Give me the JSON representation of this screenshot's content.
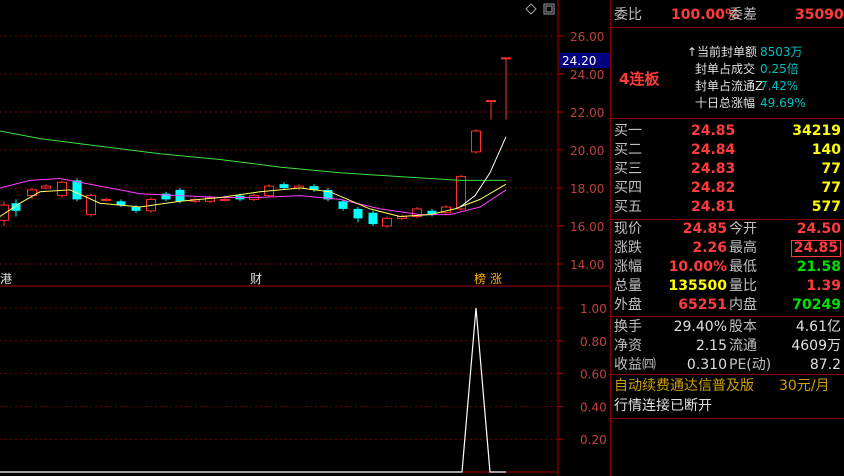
{
  "chart": {
    "price_ticks": [
      "26.00",
      "24.00",
      "22.00",
      "20.00",
      "18.00",
      "16.00",
      "14.00"
    ],
    "current_price_tag": "24.20",
    "event_tags": [
      "港",
      "财",
      "榜",
      "涨"
    ],
    "volume_ticks": [
      "1.00",
      "0.80",
      "0.60",
      "0.40",
      "0.20"
    ],
    "colors": {
      "up": "#ff3030",
      "down": "#00ffff",
      "ma1": "#ffffff",
      "ma2": "#ffff66",
      "ma3": "#ff40ff",
      "ma4": "#40e040",
      "grid": "#800000"
    }
  },
  "panel": {
    "weibi_label": "委比",
    "weibi_value": "100.00%",
    "weicha_label": "委差",
    "weicha_value": "35090",
    "lianban": "4连板",
    "seal_items": [
      {
        "label": "当前封单额",
        "value": "8503万"
      },
      {
        "label": "封单占成交",
        "value": "0.25倍"
      },
      {
        "label": "封单占流通Z",
        "value": "7.42%"
      },
      {
        "label": "十日总涨幅",
        "value": "49.69%"
      }
    ],
    "buy": [
      {
        "label": "买一",
        "price": "24.85",
        "vol": "34219"
      },
      {
        "label": "买二",
        "price": "24.84",
        "vol": "140"
      },
      {
        "label": "买三",
        "price": "24.83",
        "vol": "77"
      },
      {
        "label": "买四",
        "price": "24.82",
        "vol": "77"
      },
      {
        "label": "买五",
        "price": "24.81",
        "vol": "577"
      }
    ],
    "quote": [
      {
        "l1": "现价",
        "v1": "24.85",
        "l2": "今开",
        "v2": "24.50"
      },
      {
        "l1": "涨跌",
        "v1": "2.26",
        "l2": "最高",
        "v2": "24.85"
      },
      {
        "l1": "涨幅",
        "v1": "10.00%",
        "l2": "最低",
        "v2": "21.58"
      },
      {
        "l1": "总量",
        "v1": "135500",
        "l2": "量比",
        "v2": "1.39"
      },
      {
        "l1": "外盘",
        "v1": "65251",
        "l2": "内盘",
        "v2": "70249"
      }
    ],
    "fin": [
      {
        "l1": "换手",
        "v1": "29.40%",
        "l2": "股本",
        "v2": "4.61亿"
      },
      {
        "l1": "净资",
        "v1": "2.15",
        "l2": "流通",
        "v2": "4609万"
      },
      {
        "l1": "收益㈣",
        "v1": "0.310",
        "l2": "PE(动)",
        "v2": "87.2"
      }
    ],
    "ad_text": "自动续费通达信普及版",
    "ad_price": "30元/月",
    "status": "行情连接已断开"
  }
}
